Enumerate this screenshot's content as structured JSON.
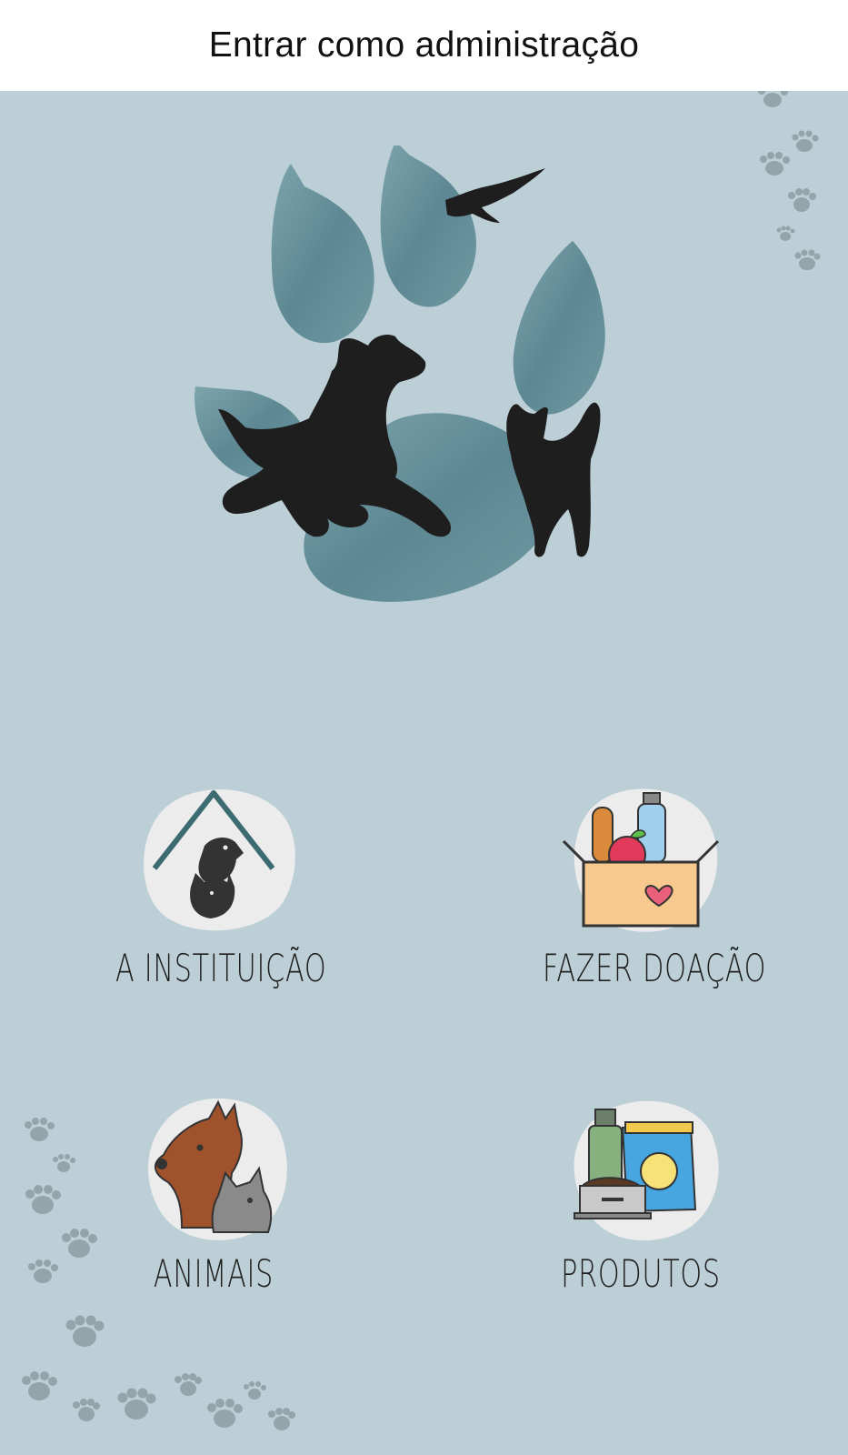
{
  "topbar": {
    "admin_link": "Entrar como administração"
  },
  "menu": {
    "instituicao": {
      "label": "A INSTITUIÇÃO",
      "icon": "house-dog-cat-icon"
    },
    "doacao": {
      "label": "FAZER DOAÇÃO",
      "icon": "donation-box-icon"
    },
    "animais": {
      "label": "ANIMAIS",
      "icon": "dog-cat-icon"
    },
    "produtos": {
      "label": "PRODUTOS",
      "icon": "pet-food-products-icon"
    }
  },
  "colors": {
    "background": "#bccfd6",
    "paw_print": "#5f8c97",
    "silhouette": "#1e1e1e",
    "blob": "#ececec",
    "accent_roof": "#3d6b72"
  }
}
